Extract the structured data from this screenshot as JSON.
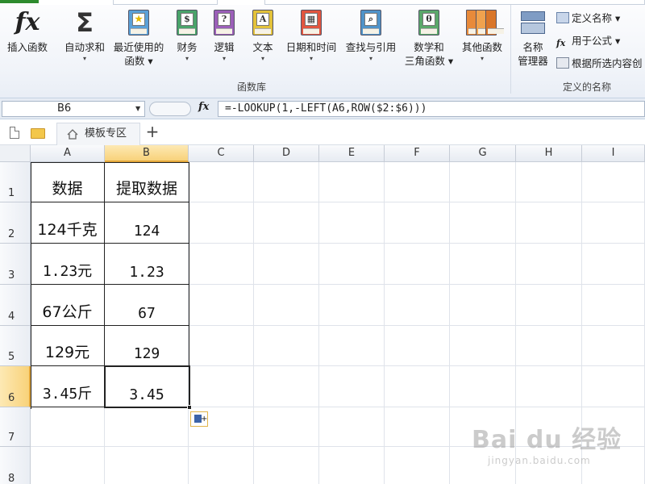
{
  "ribbon": {
    "buttons": [
      {
        "id": "insert-function",
        "label": "插入函数",
        "label2": ""
      },
      {
        "id": "autosum",
        "label": "自动求和",
        "label2": "▾"
      },
      {
        "id": "recently-used",
        "label": "最近使用的",
        "label2": "函数 ▾"
      },
      {
        "id": "financial",
        "label": "财务",
        "label2": "▾"
      },
      {
        "id": "logical",
        "label": "逻辑",
        "label2": "▾"
      },
      {
        "id": "text",
        "label": "文本",
        "label2": "▾"
      },
      {
        "id": "date-time",
        "label": "日期和时间",
        "label2": "▾"
      },
      {
        "id": "lookup",
        "label": "查找与引用",
        "label2": "▾"
      },
      {
        "id": "math-trig",
        "label": "数学和",
        "label2": "三角函数 ▾"
      },
      {
        "id": "more-functions",
        "label": "其他函数",
        "label2": "▾"
      }
    ],
    "name_manager": {
      "label": "名称",
      "label2": "管理器"
    },
    "define_name": "定义名称 ▾",
    "use_in_formula": "用于公式 ▾",
    "create_from_selection": "根据所选内容创",
    "group_function_library": "函数库",
    "group_defined_names": "定义的名称",
    "icons": {
      "fx": "fx",
      "sigma": "Σ",
      "financial": "$",
      "logical": "?",
      "text": "A",
      "date": "▦",
      "lookup": "⌕",
      "math": "θ"
    }
  },
  "formula_bar": {
    "name_box": "B6",
    "fx": "fx",
    "formula": "=-LOOKUP(1,-LEFT(A6,ROW($2:$6)))"
  },
  "tabs": {
    "template_tab": "模板专区",
    "add": "+"
  },
  "grid": {
    "columns": [
      "A",
      "B",
      "C",
      "D",
      "E",
      "F",
      "G",
      "H",
      "I"
    ],
    "rows": [
      "1",
      "2",
      "3",
      "4",
      "5",
      "6",
      "7",
      "8"
    ],
    "selected_cell": "B6",
    "data": [
      {
        "a": "数据",
        "b": "提取数据"
      },
      {
        "a": "124千克",
        "b": "124"
      },
      {
        "a": "1.23元",
        "b": "1.23"
      },
      {
        "a": "67公斤",
        "b": "67"
      },
      {
        "a": "129元",
        "b": "129"
      },
      {
        "a": "3.45斤",
        "b": "3.45"
      }
    ]
  },
  "watermark": {
    "logo": "Bai du 经验",
    "sub": "jingyan.baidu.com"
  },
  "colors": {
    "selection_header": "#f8d27a",
    "accent": "#e2a639",
    "grid_line": "#dfe3ea"
  }
}
